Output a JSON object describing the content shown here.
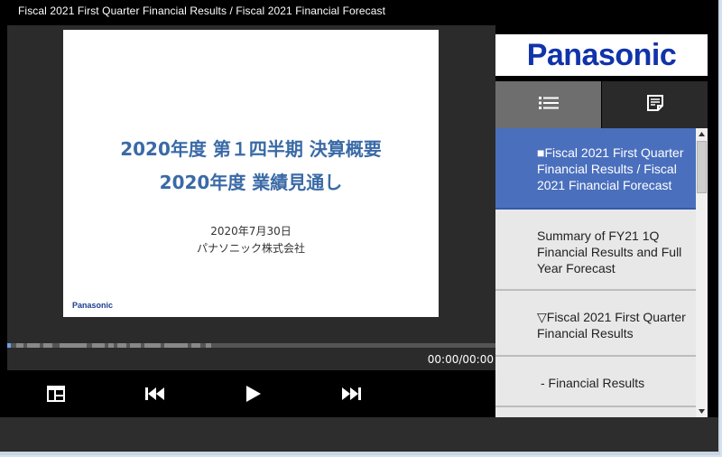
{
  "window": {
    "title": "Fiscal 2021 First Quarter Financial Results / Fiscal 2021 Financial Forecast"
  },
  "slide": {
    "title_line1": "2020年度 第１四半期 決算概要",
    "title_line2": "2020年度 業績見通し",
    "date": "2020年7月30日",
    "company": "パナソニック株式会社",
    "logo_text": "Panasonic"
  },
  "player": {
    "time": "00:00/00:00",
    "progress": 0.0,
    "controls": [
      "layout-icon",
      "skip-back-icon",
      "play-icon",
      "skip-forward-icon"
    ]
  },
  "sidebar": {
    "brand": "Panasonic",
    "brand_color": "#1133aa",
    "tabs": [
      "list-icon",
      "notes-icon"
    ],
    "items": [
      {
        "label": "■Fiscal 2021 First Quarter Financial Results / Fiscal 2021 Financial Forecast",
        "active": true
      },
      {
        "label": "Summary of FY21 1Q Financial Results and Full Year Forecast",
        "active": false
      },
      {
        "label": "▽Fiscal 2021 First Quarter Financial Results",
        "active": false
      },
      {
        "label": " - Financial Results",
        "active": false
      }
    ]
  },
  "colors": {
    "accent": "#4a6fbd",
    "slide_title": "#3a6aa6"
  }
}
